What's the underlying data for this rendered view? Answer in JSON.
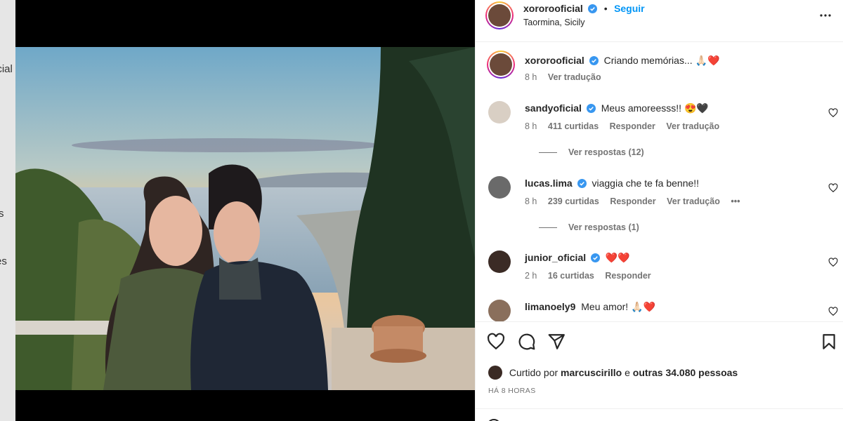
{
  "background_fragments": [
    "icial",
    "s",
    "es"
  ],
  "post": {
    "username": "xororooficial",
    "follow_label": "Seguir",
    "separator": "•",
    "location": "Taormina, Sicily",
    "caption": "Criando memórias... 🙏🏻❤️",
    "caption_time": "8 h",
    "caption_translate": "Ver tradução"
  },
  "comments": [
    {
      "username": "sandyoficial",
      "verified": true,
      "text": "Meus amoreesss!! 😍🖤",
      "time": "8 h",
      "likes": "411 curtidas",
      "reply": "Responder",
      "translate": "Ver tradução",
      "replies": "Ver respostas (12)"
    },
    {
      "username": "lucas.lima",
      "verified": true,
      "text": "viaggia che te fa benne!!",
      "time": "8 h",
      "likes": "239 curtidas",
      "reply": "Responder",
      "translate": "Ver tradução",
      "more": "•••",
      "replies": "Ver respostas (1)"
    },
    {
      "username": "junior_oficial",
      "verified": true,
      "text": "❤️❤️",
      "time": "2 h",
      "likes": "16 curtidas",
      "reply": "Responder"
    },
    {
      "username": "limanoely9",
      "verified": false,
      "text": "Meu amor! 🙏🏻❤️"
    }
  ],
  "actions": {
    "liked_by_prefix": "Curtido por",
    "liked_by_user": "marcuscirillo",
    "liked_by_conj": "e",
    "liked_by_others": "outras 34.080 pessoas",
    "time_ago": "HÁ 8 HORAS"
  },
  "icons": {
    "verified": "verified-badge-icon",
    "more": "more-options-icon",
    "like": "heart-icon",
    "comment": "comment-icon",
    "share": "share-icon",
    "save": "bookmark-icon"
  },
  "colors": {
    "accent": "#0095f6",
    "verified": "#3897f0",
    "muted": "#737373",
    "text": "#262626"
  }
}
